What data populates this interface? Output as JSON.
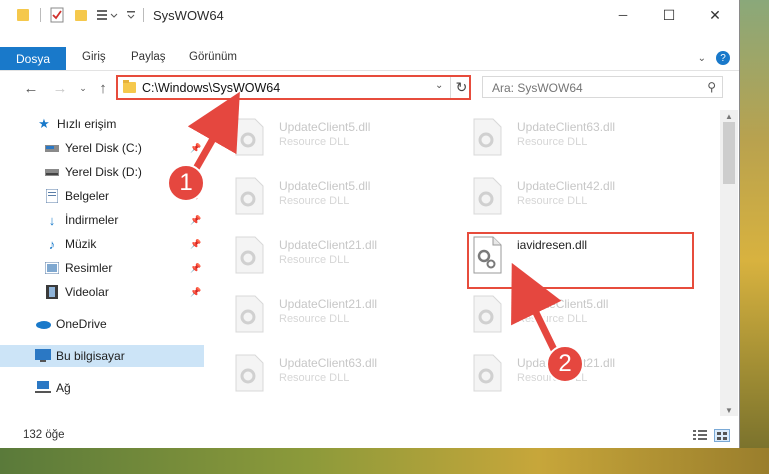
{
  "window": {
    "title": "SysWOW64",
    "controls": {
      "minimize": "─",
      "maximize": "☐",
      "close": "✕"
    }
  },
  "ribbon": {
    "file_tab": "Dosya",
    "tabs": [
      "Giriş",
      "Paylaş",
      "Görünüm"
    ]
  },
  "address": {
    "path": "C:\\Windows\\SysWOW64"
  },
  "search": {
    "placeholder": "Ara: SysWOW64"
  },
  "sidebar": {
    "items": [
      {
        "label": "Hızlı erişim",
        "icon": "star-icon"
      },
      {
        "label": "Yerel Disk (C:)",
        "icon": "drive-icon"
      },
      {
        "label": "Yerel Disk (D:)",
        "icon": "drive-icon"
      },
      {
        "label": "Belgeler",
        "icon": "documents-icon"
      },
      {
        "label": "İndirmeler",
        "icon": "download-icon"
      },
      {
        "label": "Müzik",
        "icon": "music-icon"
      },
      {
        "label": "Resimler",
        "icon": "pictures-icon"
      },
      {
        "label": "Videolar",
        "icon": "video-icon"
      },
      {
        "label": "OneDrive",
        "icon": "cloud-icon"
      },
      {
        "label": "Bu bilgisayar",
        "icon": "computer-icon"
      },
      {
        "label": "Ağ",
        "icon": "network-icon"
      }
    ]
  },
  "files": [
    {
      "name": "UpdateClient5.dll",
      "type": "Resource DLL"
    },
    {
      "name": "UpdateClient63.dll",
      "type": "Resource DLL"
    },
    {
      "name": "UpdateClient5.dll",
      "type": "Resource DLL"
    },
    {
      "name": "UpdateClient42.dll",
      "type": "Resource DLL"
    },
    {
      "name": "UpdateClient21.dll",
      "type": "Resource DLL"
    },
    {
      "name": "iavidresen.dll",
      "type": ""
    },
    {
      "name": "UpdateClient21.dll",
      "type": "Resource DLL"
    },
    {
      "name": "UpdateClient5.dll",
      "type": "Resource DLL"
    },
    {
      "name": "UpdateClient63.dll",
      "type": "Resource DLL"
    },
    {
      "name": "UpdateClient21.dll",
      "type": "Resource DLL"
    }
  ],
  "status": {
    "count": "132 öğe"
  },
  "annotations": {
    "step1": "1",
    "step2": "2",
    "color": "#e5473f"
  }
}
